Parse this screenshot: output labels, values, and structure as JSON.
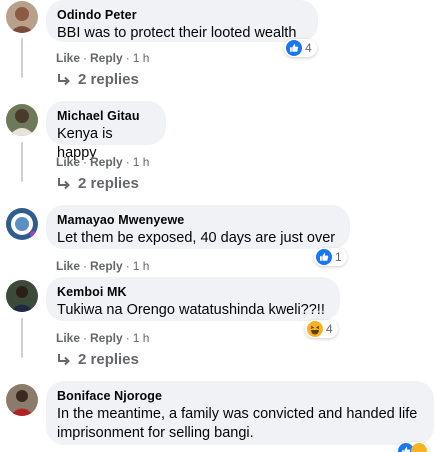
{
  "comments": [
    {
      "author": "Odindo Peter",
      "text": "BBI was to protect their looted wealth",
      "like_label": "Like",
      "reply_label": "Reply",
      "time": "1 h",
      "reaction_count": "4",
      "reaction_icons": [
        "like-icon"
      ],
      "replies_label": "2 replies"
    },
    {
      "author": "Michael Gitau",
      "text": "Kenya is happy",
      "like_label": "Like",
      "reply_label": "Reply",
      "time": "1 h",
      "replies_label": "2 replies"
    },
    {
      "author": "Mamayao Mwenyewe",
      "text": "Let them be exposed, 40 days are just over",
      "like_label": "Like",
      "reply_label": "Reply",
      "time": "1 h",
      "reaction_count": "1",
      "reaction_icons": [
        "like-icon"
      ]
    },
    {
      "author": "Kemboi MK",
      "text": "Tukiwa na Orengo watatushinda kweli??!!",
      "like_label": "Like",
      "reply_label": "Reply",
      "time": "1 h",
      "reaction_count": "4",
      "reaction_icons": [
        "haha-icon"
      ],
      "replies_label": "2 replies"
    },
    {
      "author": "Boniface Njoroge",
      "text": "In the meantime, a family was convicted and handed life imprisonment for selling bangi.",
      "reaction_icons": [
        "like-icon",
        "haha-icon"
      ]
    }
  ],
  "separator": "·",
  "colors": {
    "bubble_bg": "#f0f2f5",
    "like_blue": "#1877f2",
    "haha_yellow": "#f7b125",
    "meta_gray": "#65676b"
  }
}
